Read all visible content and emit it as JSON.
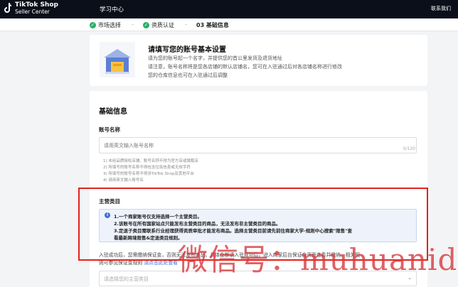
{
  "topbar": {
    "logo_line1": "TikTok Shop",
    "logo_line2": "Seller Center",
    "nav_study": "学习中心",
    "contact": "联系我们"
  },
  "steps": [
    {
      "label": "市场选择",
      "done": true
    },
    {
      "label": "资质认证",
      "done": true
    },
    {
      "label": "03 基础信息",
      "done": false
    }
  ],
  "intro": {
    "title": "请填写您的账号基本设置",
    "lines": [
      "请为您的账号起一个名字，并提供您的首公里发货及退货地址",
      "请注意，账号名称将是您各店铺的默认店铺名，您可在入驻通过后对各店铺名称进行修改",
      "您的仓库信息也可在入驻通过后调整"
    ]
  },
  "form": {
    "section_title": "基础信息",
    "account_label": "账号名称",
    "account_placeholder": "请用英文输入账号名称",
    "counter": "0/120",
    "rules": [
      "1) 未经品牌授权店铺，账号名称不得为官方店或旗舰店",
      "2) 所填写的账号名称不得包含垃圾信息或无效字符",
      "3) 所填写的账号名称不得涉TikTok Shop及其他平台",
      "4) 请用英文输入账号名"
    ],
    "category_label": "主营类目",
    "notice": [
      "1.一个商家账号仅支持选择一个主营类目。",
      "2.该账号在所有国家站点只能发布主营类目的商品，无法发布非主营类目的商品。",
      "3.定退子类目需联系行业经理获得资质审批才能发布商品。选择主营类目前请先前往商家大学-规则中心搜索\"限售\"查",
      "看最新跨境限售&定退类目规则。"
    ],
    "below_line1": "入驻成功后，您需缴纳保证金，否则无法发布商品。具体金额请入驻成功后，进入商家后台保证金页面查看并缴纳。相关规",
    "below_line2_prefix": "则可参见保证金规则",
    "below_link": "请点击此处查看",
    "select_placeholder": "请选择您的主营类目"
  },
  "watermark": "微信号：muhuanide"
}
